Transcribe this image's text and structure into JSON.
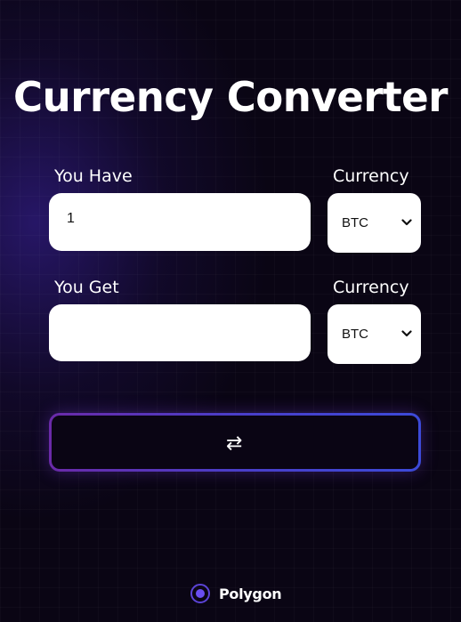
{
  "title": "Currency Converter",
  "have": {
    "label": "You Have",
    "value": "1"
  },
  "get": {
    "label": "You Get",
    "value": ""
  },
  "currency_from": {
    "label": "Currency",
    "selected": "BTC"
  },
  "currency_to": {
    "label": "Currency",
    "selected": "BTC"
  },
  "swap_button": {
    "icon": "swap-arrows-icon",
    "glyph": "⇄"
  },
  "footer": {
    "brand": "Polygon",
    "logo_icon": "polygon-logo-icon"
  },
  "colors": {
    "background": "#0a0514",
    "accent_purple": "#6a2aa8",
    "accent_blue": "#3c4ad8",
    "field_bg": "#ffffff"
  }
}
